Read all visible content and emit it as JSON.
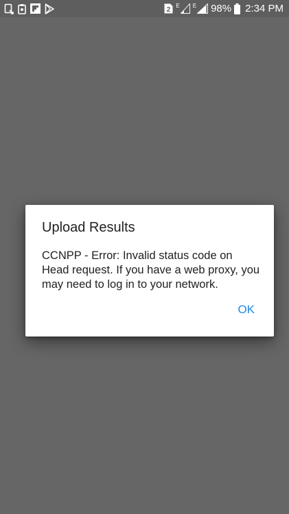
{
  "status_bar": {
    "left_icons": [
      "screenshot-icon",
      "clipboard-icon",
      "flipboard-icon",
      "play-store-icon"
    ],
    "sim_badge": "2",
    "network_type_1": "E",
    "network_type_2": "E",
    "battery_percent": "98%",
    "time": "2:34 PM"
  },
  "dialog": {
    "title": "Upload Results",
    "message": "CCNPP - Error: Invalid status code on Head request. If you have a web proxy, you may need to log in to your network.",
    "ok_label": "OK"
  },
  "colors": {
    "scrim": "#666666",
    "dialog_background": "#ffffff",
    "accent": "#1e88e5",
    "text": "#212121"
  }
}
